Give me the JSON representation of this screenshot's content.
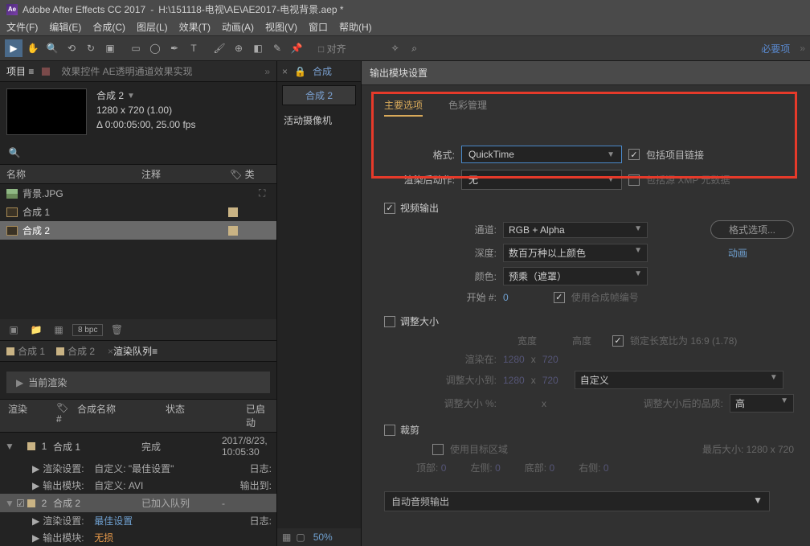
{
  "titlebar": {
    "app": "Adobe After Effects CC 2017",
    "path": "H:\\151118-电视\\AE\\AE2017-电视背景.aep *"
  },
  "menu": {
    "file": "文件(F)",
    "edit": "编辑(E)",
    "comp": "合成(C)",
    "layer": "图层(L)",
    "effect": "效果(T)",
    "anim": "动画(A)",
    "view": "视图(V)",
    "window": "窗口",
    "help": "帮助(H)"
  },
  "toolbar": {
    "snap": "□ 对齐",
    "req": "必要项"
  },
  "project": {
    "tab_project": "项目 ≡",
    "tab_effects": "效果控件 AE透明通道效果实现",
    "comp_name": "合成 2",
    "dims": "1280 x 720 (1.00)",
    "duration": "Δ 0:00:05:00, 25.00 fps",
    "hdr_name": "名称",
    "hdr_comment": "注释",
    "hdr_type": "类",
    "items": [
      {
        "icon": "img",
        "label": "背景.JPG",
        "hasSwatch": false,
        "tree": "t"
      },
      {
        "icon": "comp",
        "label": "合成 1",
        "hasSwatch": true
      },
      {
        "icon": "comp",
        "label": "合成 2",
        "hasSwatch": true,
        "selected": true
      }
    ],
    "bpc": "8 bpc"
  },
  "viewer": {
    "tab": "合成",
    "comp_tab": "合成 2",
    "active_cam": "活动摄像机",
    "zoom": "50%"
  },
  "timeline_tabs": {
    "t1": "合成 1",
    "t2": "合成 2",
    "t3": "渲染队列"
  },
  "rq": {
    "current": "当前渲染",
    "h_render": "渲染",
    "h_idx": "#",
    "h_name": "合成名称",
    "h_status": "状态",
    "h_start": "已启动",
    "rows": [
      {
        "idx": "1",
        "name": "合成 1",
        "status": "完成",
        "start": "2017/8/23, 10:05:30"
      },
      {
        "idx": "2",
        "name": "合成 2",
        "status": "已加入队列",
        "start": "-"
      }
    ],
    "sub_render": "渲染设置:",
    "sub_render_v1": "自定义: \"最佳设置\"",
    "sub_render_v2": "最佳设置",
    "sub_out": "输出模块:",
    "sub_out_v1": "自定义: AVI",
    "sub_out_v2": "无损",
    "log": "日志:",
    "out_to": "输出到:"
  },
  "dialog": {
    "title": "输出模块设置",
    "tab_main": "主要选项",
    "tab_color": "色彩管理",
    "fmt_label": "格式:",
    "fmt_value": "QuickTime",
    "post_label": "渲染后动作:",
    "post_value": "无",
    "include_link": "包括项目链接",
    "include_xmp": "包括源 XMP 元数据",
    "video_out": "视频输出",
    "channel_l": "通道:",
    "channel_v": "RGB + Alpha",
    "depth_l": "深度:",
    "depth_v": "数百万种以上颜色",
    "color_l": "颜色:",
    "color_v": "预乘（遮罩）",
    "start_l": "开始 #:",
    "start_v": "0",
    "use_comp_frame": "使用合成帧编号",
    "fmt_opts": "格式选项...",
    "anim": "动画",
    "resize": "调整大小",
    "width": "宽度",
    "height": "高度",
    "lock_aspect": "锁定长宽比为 16:9 (1.78)",
    "render_at": "渲染在:",
    "r_w": "1280",
    "r_h": "720",
    "resize_to": "调整大小到:",
    "custom": "自定义",
    "resize_pct": "调整大小 %:",
    "resize_q": "调整大小后的品质:",
    "quality": "高",
    "crop": "裁剪",
    "use_roi": "使用目标区域",
    "final": "最后大小: 1280 x 720",
    "top": "顶部:",
    "left": "左侧:",
    "bottom": "底部:",
    "right": "右侧:",
    "zero": "0",
    "auto_audio": "自动音频输出"
  }
}
